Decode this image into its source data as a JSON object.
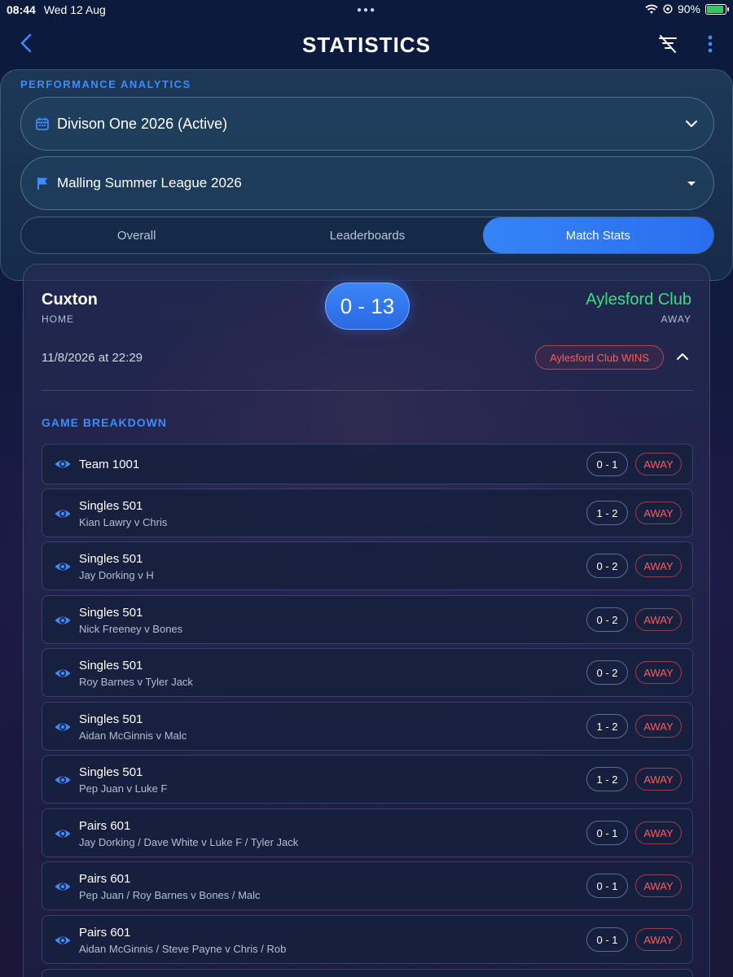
{
  "status_bar": {
    "time": "08:44",
    "date": "Wed 12 Aug",
    "battery": "90%"
  },
  "nav": {
    "title": "STATISTICS"
  },
  "filters": {
    "section_label": "PERFORMANCE ANALYTICS",
    "season": "Divison One 2026 (Active)",
    "league": "Malling Summer League 2026"
  },
  "tabs": [
    {
      "label": "Overall",
      "active": false
    },
    {
      "label": "Leaderboards",
      "active": false
    },
    {
      "label": "Match Stats",
      "active": true
    }
  ],
  "match": {
    "home_team": "Cuxton",
    "home_label": "HOME",
    "away_team": "Aylesford Club",
    "away_label": "AWAY",
    "score": "0 - 13",
    "date": "11/8/2026 at 22:29",
    "winner": "Aylesford Club WINS"
  },
  "breakdown": {
    "label": "GAME BREAKDOWN",
    "games": [
      {
        "name": "Team 1001",
        "players": "",
        "score": "0 - 1",
        "result": "AWAY"
      },
      {
        "name": "Singles 501",
        "players": "Kian Lawry v Chris",
        "score": "1 - 2",
        "result": "AWAY"
      },
      {
        "name": "Singles 501",
        "players": "Jay Dorking v H",
        "score": "0 - 2",
        "result": "AWAY"
      },
      {
        "name": "Singles 501",
        "players": "Nick Freeney v Bones",
        "score": "0 - 2",
        "result": "AWAY"
      },
      {
        "name": "Singles 501",
        "players": "Roy Barnes v Tyler Jack",
        "score": "0 - 2",
        "result": "AWAY"
      },
      {
        "name": "Singles 501",
        "players": "Aidan McGinnis v Malc",
        "score": "1 - 2",
        "result": "AWAY"
      },
      {
        "name": "Singles 501",
        "players": "Pep Juan v Luke F",
        "score": "1 - 2",
        "result": "AWAY"
      },
      {
        "name": "Pairs 601",
        "players": "Jay Dorking / Dave White v Luke F / Tyler Jack",
        "score": "0 - 1",
        "result": "AWAY"
      },
      {
        "name": "Pairs 601",
        "players": "Pep Juan / Roy Barnes v Bones / Malc",
        "score": "0 - 1",
        "result": "AWAY"
      },
      {
        "name": "Pairs 601",
        "players": "Aidan McGinnis / Steve Payne v Chris / Rob",
        "score": "0 - 1",
        "result": "AWAY"
      }
    ]
  },
  "colors": {
    "accent": "#3d8bff",
    "home_win": "#3ddc84",
    "away_result": "#ff5a5a"
  }
}
